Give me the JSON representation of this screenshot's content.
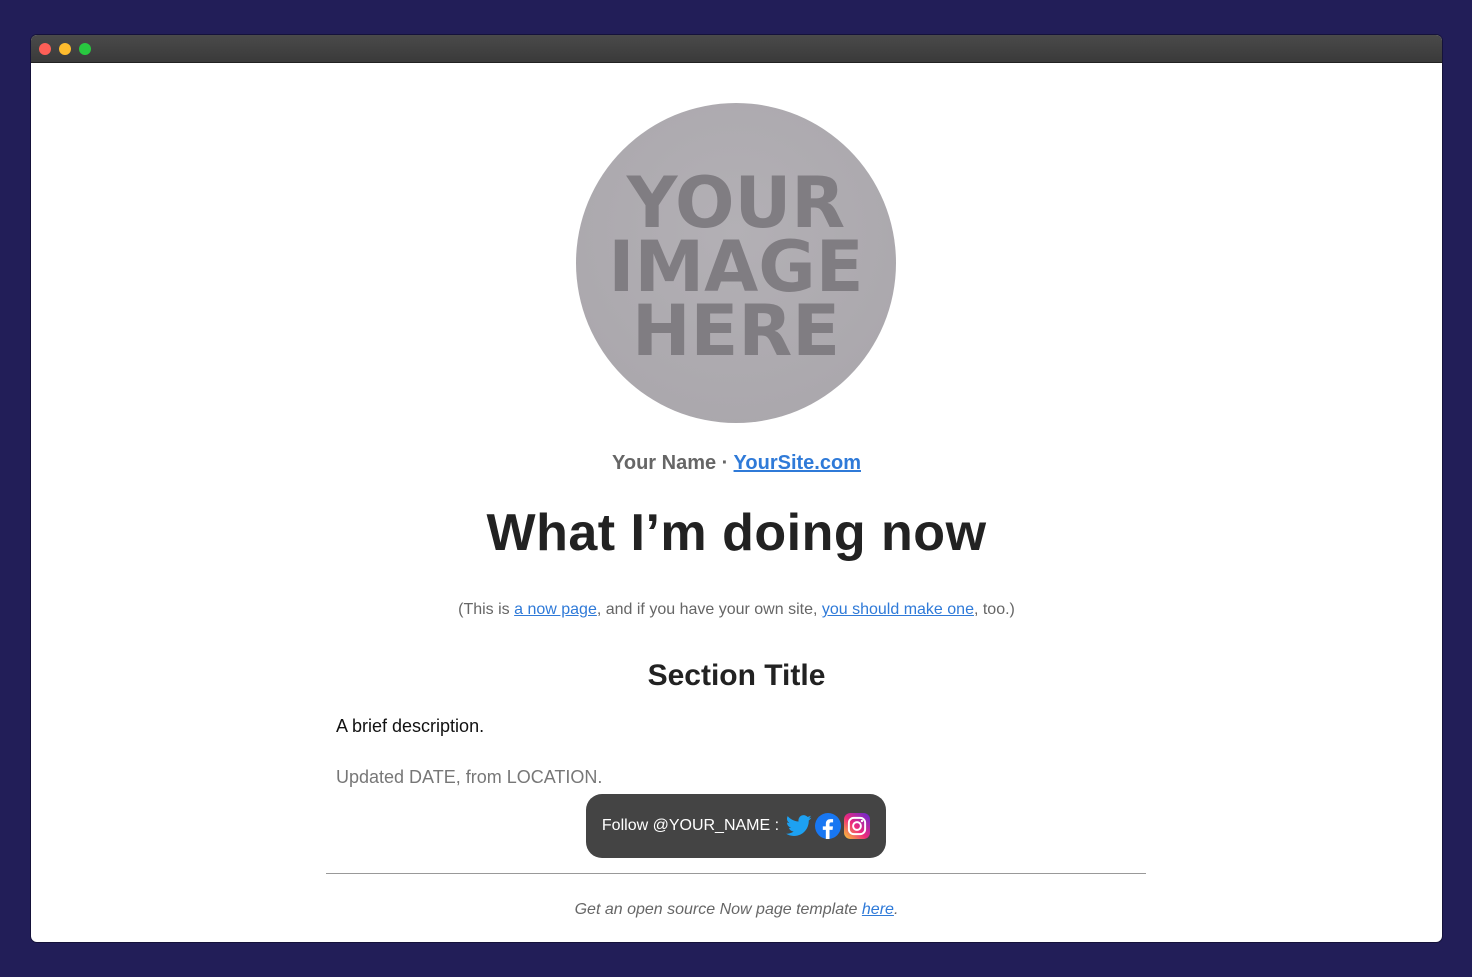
{
  "window": {
    "controls": [
      "close",
      "minimize",
      "maximize"
    ]
  },
  "avatar": {
    "placeholder_lines": [
      "YOUR",
      "IMAGE",
      "HERE"
    ]
  },
  "byline": {
    "name": "Your Name",
    "separator": " · ",
    "site_link": "YourSite.com"
  },
  "heading": "What I’m doing now",
  "intro": {
    "prefix": "(This is ",
    "link1": "a now page",
    "middle": ", and if you have your own site, ",
    "link2": "you should make one",
    "suffix": ", too.)"
  },
  "section": {
    "title": "Section Title",
    "description": "A brief description.",
    "updated": "Updated DATE, from LOCATION."
  },
  "follow": {
    "label": "Follow @YOUR_NAME :",
    "icons": [
      "twitter-icon",
      "facebook-icon",
      "instagram-icon"
    ]
  },
  "footer": {
    "prefix": "Get an open source Now page template ",
    "link": "here",
    "suffix": "."
  },
  "colors": {
    "background": "#221e58",
    "link": "#2f7ad8",
    "follow_bg": "#444444",
    "twitter": "#1da1f2",
    "facebook": "#1877f2"
  }
}
